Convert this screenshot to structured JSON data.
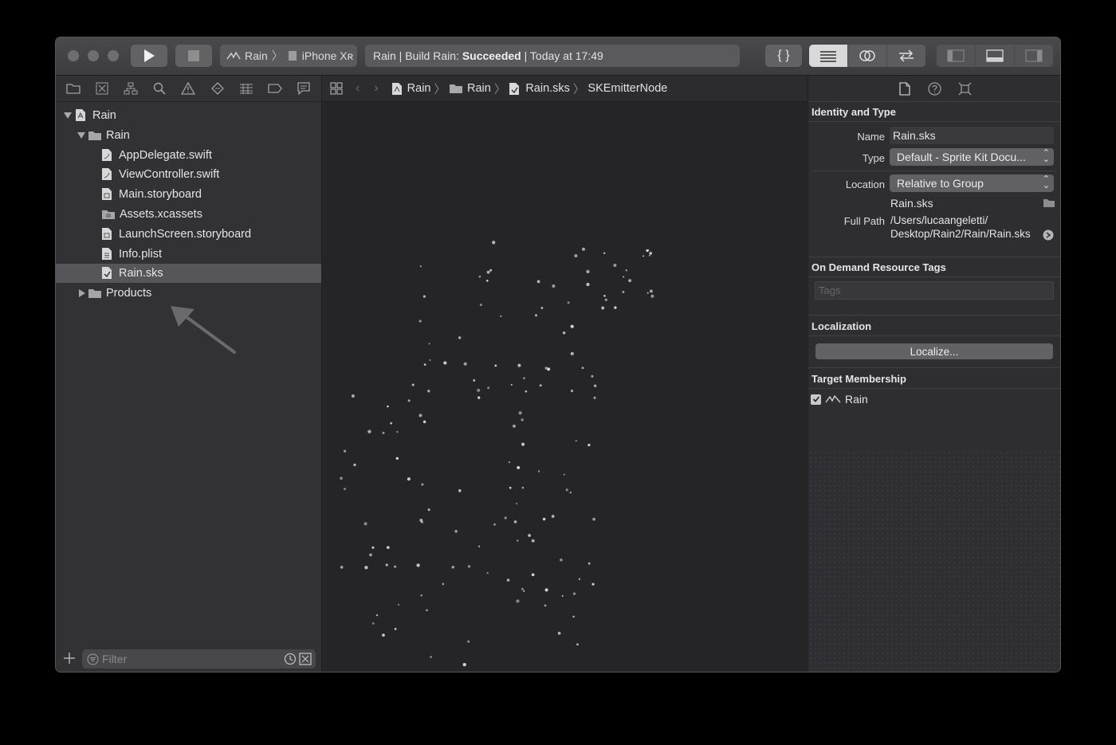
{
  "toolbar": {
    "scheme_target": "Rain",
    "scheme_device": "iPhone Xʀ",
    "status_prefix": "Rain | Build Rain: ",
    "status_result": "Succeeded",
    "status_suffix": " | Today at 17:49",
    "library_label": "{ }"
  },
  "navigator": {
    "tree": [
      {
        "label": "Rain",
        "level": 0,
        "icon": "project-icon",
        "disclosure": "open"
      },
      {
        "label": "Rain",
        "level": 1,
        "icon": "folder-icon",
        "disclosure": "open"
      },
      {
        "label": "AppDelegate.swift",
        "level": 2,
        "icon": "swift-file-icon"
      },
      {
        "label": "ViewController.swift",
        "level": 2,
        "icon": "swift-file-icon"
      },
      {
        "label": "Main.storyboard",
        "level": 2,
        "icon": "storyboard-file-icon"
      },
      {
        "label": "Assets.xcassets",
        "level": 2,
        "icon": "assets-folder-icon"
      },
      {
        "label": "LaunchScreen.storyboard",
        "level": 2,
        "icon": "storyboard-file-icon"
      },
      {
        "label": "Info.plist",
        "level": 2,
        "icon": "plist-file-icon"
      },
      {
        "label": "Rain.sks",
        "level": 2,
        "icon": "sks-file-icon",
        "selected": true
      },
      {
        "label": "Products",
        "level": 1,
        "icon": "folder-icon",
        "disclosure": "closed"
      }
    ],
    "filter_placeholder": "Filter"
  },
  "editor": {
    "jumpbar": [
      "Rain",
      "Rain",
      "Rain.sks",
      "SKEmitterNode"
    ]
  },
  "inspector": {
    "identity_title": "Identity and Type",
    "name_label": "Name",
    "name_value": "Rain.sks",
    "type_label": "Type",
    "type_value": "Default - Sprite Kit Docu...",
    "location_label": "Location",
    "location_value": "Relative to Group",
    "location_file": "Rain.sks",
    "fullpath_label": "Full Path",
    "fullpath_line1": "/Users/lucaangeletti/",
    "fullpath_line2": "Desktop/Rain2/Rain/Rain.sks",
    "ondemand_title": "On Demand Resource Tags",
    "tags_placeholder": "Tags",
    "localization_title": "Localization",
    "localize_button": "Localize...",
    "target_title": "Target Membership",
    "target_name": "Rain",
    "target_checked": true
  },
  "colors": {
    "window_bg": "#2a2a2c",
    "selection": "#56565a",
    "particle": "#d8d8d8"
  }
}
